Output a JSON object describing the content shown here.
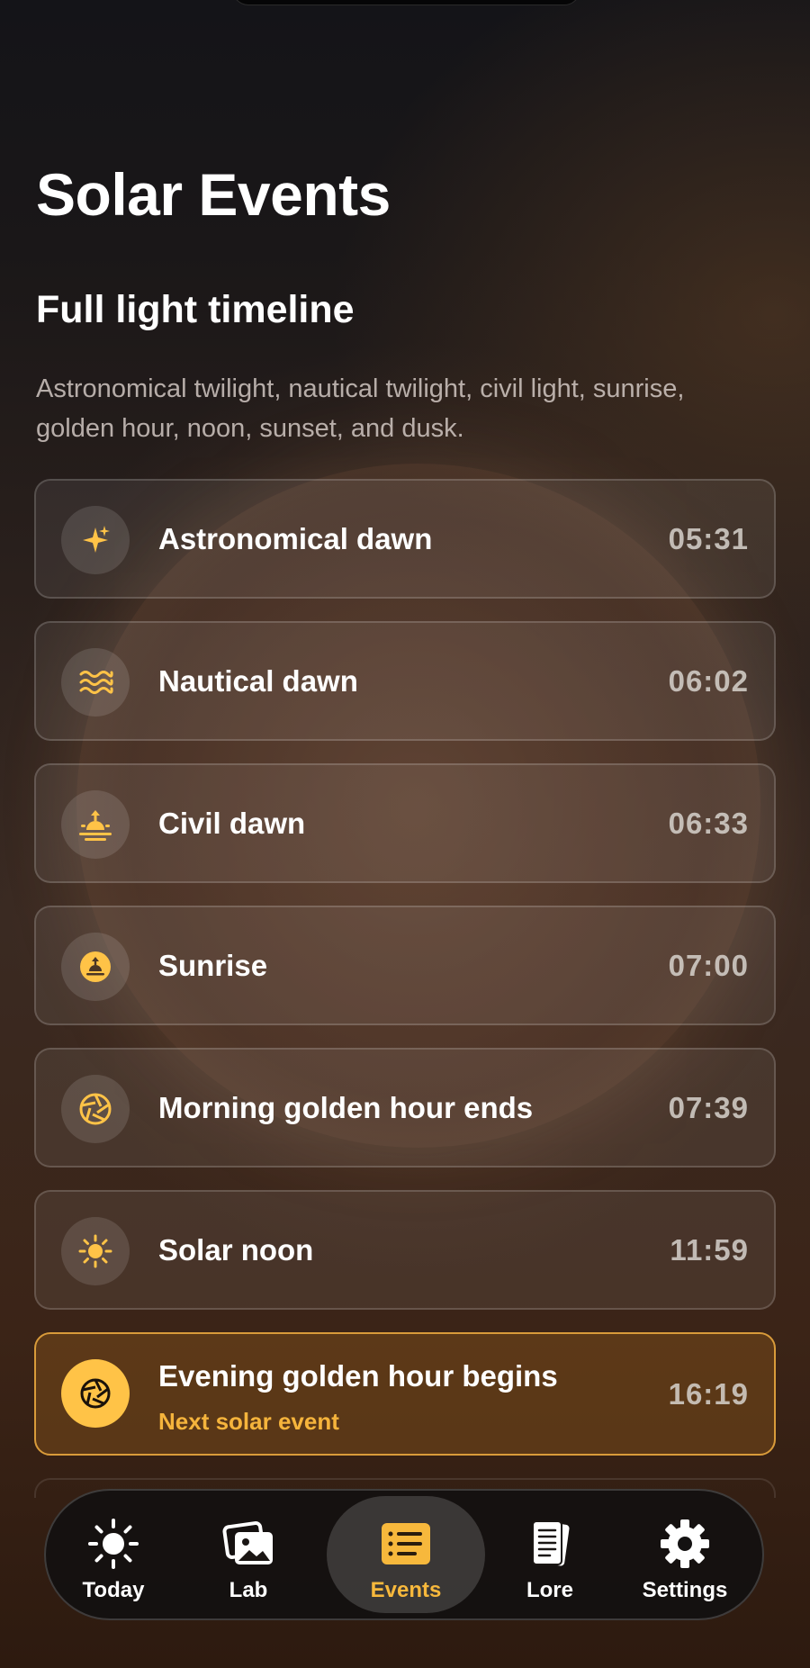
{
  "header": {
    "title": "Solar Events",
    "section_title": "Full light timeline",
    "subtitle": "Astronomical twilight, nautical twilight, civil light, sunrise, golden hour, noon, sunset, and dusk."
  },
  "events": [
    {
      "label": "Astronomical dawn",
      "time": "05:31",
      "icon": "sparkles-icon"
    },
    {
      "label": "Nautical dawn",
      "time": "06:02",
      "icon": "waves-icon"
    },
    {
      "label": "Civil dawn",
      "time": "06:33",
      "icon": "sunrise-horizon-icon"
    },
    {
      "label": "Sunrise",
      "time": "07:00",
      "icon": "sunrise-icon"
    },
    {
      "label": "Morning golden hour ends",
      "time": "07:39",
      "icon": "aperture-icon"
    },
    {
      "label": "Solar noon",
      "time": "11:59",
      "icon": "sun-icon"
    },
    {
      "label": "Evening golden hour begins",
      "time": "16:19",
      "icon": "aperture-icon",
      "sublabel": "Next solar event"
    }
  ],
  "tabs": [
    {
      "label": "Today",
      "icon": "sun-icon"
    },
    {
      "label": "Lab",
      "icon": "photos-icon"
    },
    {
      "label": "Events",
      "icon": "list-icon",
      "active": true
    },
    {
      "label": "Lore",
      "icon": "book-icon"
    },
    {
      "label": "Settings",
      "icon": "gear-icon"
    }
  ],
  "colors": {
    "accent": "#f7b83c",
    "icon_gold": "#ffc347",
    "next_border": "#d99b3a"
  }
}
